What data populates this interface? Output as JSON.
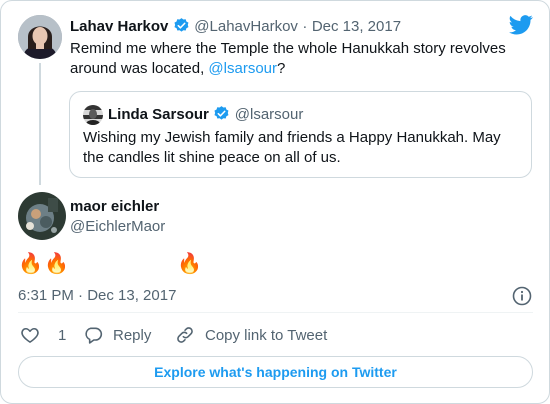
{
  "parent_tweet": {
    "display_name": "Lahav Harkov",
    "handle": "@LahavHarkov",
    "separator": "·",
    "date": "Dec 13, 2017",
    "text_before_mention": "Remind me where the Temple the whole Hanukkah story revolves around was located, ",
    "mention": "@lsarsour",
    "text_after_mention": "?"
  },
  "quoted_tweet": {
    "display_name": "Linda Sarsour",
    "handle": "@lsarsour",
    "text": "Wishing my Jewish family and friends a Happy Hanukkah. May the  candles lit shine peace on all of us."
  },
  "reply": {
    "display_name": "maor eichler",
    "handle": "@EichlerMaor",
    "emojis": [
      "🔥",
      "🔥",
      "🔥"
    ],
    "timestamp": "6:31 PM · Dec 13, 2017"
  },
  "actions": {
    "like_count": "1",
    "reply_label": "Reply",
    "copy_link_label": "Copy link to Tweet"
  },
  "footer": {
    "explore_label": "Explore what's happening on Twitter"
  },
  "colors": {
    "accent": "#1d9bf0",
    "text": "#0f1419",
    "muted": "#536471",
    "border": "#cfd9de",
    "fire": "#f28c1b"
  },
  "icons": {
    "brand": "twitter-bird-icon",
    "verified": "verified-badge-icon",
    "info": "info-icon",
    "like": "heart-icon",
    "reply": "speech-bubble-icon",
    "copy_link": "link-icon"
  }
}
